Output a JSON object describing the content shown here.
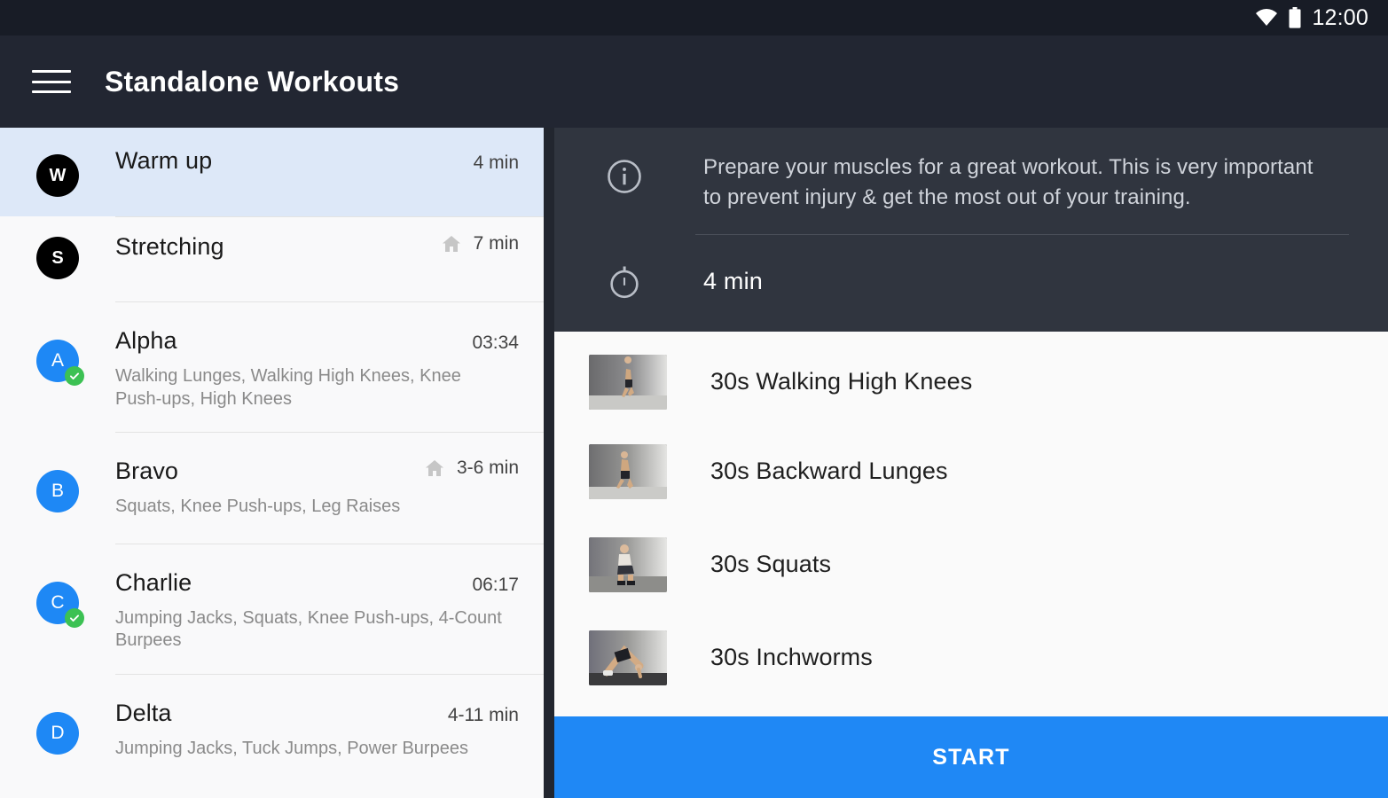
{
  "status_bar": {
    "time": "12:00",
    "wifi_icon": "wifi-icon",
    "battery_icon": "battery-icon"
  },
  "app_bar": {
    "menu_icon": "hamburger-menu-icon",
    "title": "Standalone Workouts"
  },
  "workout_list": {
    "items": [
      {
        "avatar_letter": "W",
        "avatar_style": "dark",
        "title": "Warm up",
        "duration": "4 min",
        "subtitle": "",
        "home": false,
        "completed": false,
        "selected": true
      },
      {
        "avatar_letter": "S",
        "avatar_style": "dark",
        "title": "Stretching",
        "duration": "7 min",
        "subtitle": "",
        "home": true,
        "completed": false,
        "selected": false
      },
      {
        "avatar_letter": "A",
        "avatar_style": "blue",
        "title": "Alpha",
        "duration": "03:34",
        "subtitle": "Walking Lunges, Walking High Knees, Knee Push-ups, High Knees",
        "home": false,
        "completed": true,
        "selected": false
      },
      {
        "avatar_letter": "B",
        "avatar_style": "blue",
        "title": "Bravo",
        "duration": "3-6 min",
        "subtitle": "Squats, Knee Push-ups, Leg Raises",
        "home": true,
        "completed": false,
        "selected": false
      },
      {
        "avatar_letter": "C",
        "avatar_style": "blue",
        "title": "Charlie",
        "duration": "06:17",
        "subtitle": "Jumping Jacks, Squats, Knee Push-ups, 4-Count Burpees",
        "home": false,
        "completed": true,
        "selected": false
      },
      {
        "avatar_letter": "D",
        "avatar_style": "blue",
        "title": "Delta",
        "duration": "4-11 min",
        "subtitle": "Jumping Jacks, Tuck Jumps, Power Burpees",
        "home": false,
        "completed": false,
        "selected": false
      }
    ]
  },
  "detail": {
    "info_icon": "info-circle-icon",
    "description": "Prepare your muscles for a great workout. This is very important to prevent injury & get the most out of your training.",
    "timer_icon": "stopwatch-icon",
    "duration": "4 min",
    "exercises": [
      {
        "label": "30s Walking High Knees",
        "thumb": "exercise-thumbnail-walking-high-knees"
      },
      {
        "label": "30s Backward Lunges",
        "thumb": "exercise-thumbnail-backward-lunges"
      },
      {
        "label": "30s Squats",
        "thumb": "exercise-thumbnail-squats"
      },
      {
        "label": "30s Inchworms",
        "thumb": "exercise-thumbnail-inchworms"
      },
      {
        "label": "",
        "thumb": "exercise-thumbnail-partial"
      }
    ]
  },
  "start_button": {
    "label": "START",
    "color": "#1f88f5"
  },
  "colors": {
    "accent_blue": "#1e88f5",
    "selected_row": "#dde8f8",
    "dark_panel": "#30353f",
    "app_bar": "#222632",
    "check_green": "#3cc153"
  }
}
